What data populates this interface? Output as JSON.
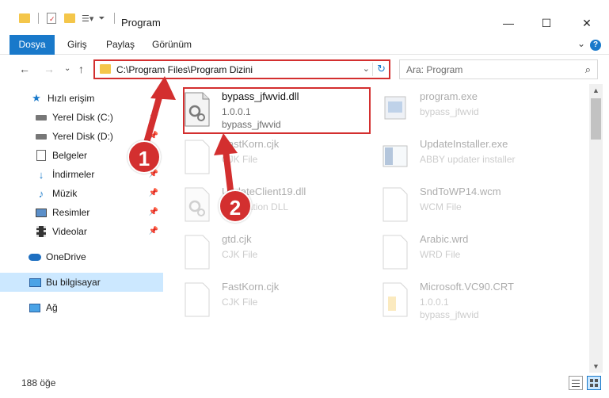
{
  "window": {
    "title": "Program",
    "minimize": "—",
    "maximize": "☐",
    "close": "✕"
  },
  "ribbon": {
    "tabs": [
      {
        "label": "Dosya",
        "active": true
      },
      {
        "label": "Giriş",
        "active": false
      },
      {
        "label": "Paylaş",
        "active": false
      },
      {
        "label": "Görünüm",
        "active": false
      }
    ],
    "help": "?"
  },
  "address": {
    "path": "C:\\Program Files\\Program Dizini",
    "search_placeholder": "Ara: Program"
  },
  "nav": {
    "items": [
      {
        "label": "Hızlı erişim",
        "icon": "star-icon",
        "pinned": false
      },
      {
        "label": "Yerel Disk (C:)",
        "icon": "drive-icon",
        "pinned": true
      },
      {
        "label": "Yerel Disk (D:)",
        "icon": "drive-icon",
        "pinned": true
      },
      {
        "label": "Belgeler",
        "icon": "documents-icon",
        "pinned": true
      },
      {
        "label": "İndirmeler",
        "icon": "download-icon",
        "pinned": true
      },
      {
        "label": "Müzik",
        "icon": "music-icon",
        "pinned": true
      },
      {
        "label": "Resimler",
        "icon": "pictures-icon",
        "pinned": true
      },
      {
        "label": "Videolar",
        "icon": "video-icon",
        "pinned": true
      },
      {
        "label": "OneDrive",
        "icon": "cloud-icon",
        "pinned": false
      },
      {
        "label": "Bu bilgisayar",
        "icon": "computer-icon",
        "pinned": false,
        "selected": true
      },
      {
        "label": "Ağ",
        "icon": "network-icon",
        "pinned": false
      }
    ]
  },
  "files": [
    {
      "name": "bypass_jfwvid.dll",
      "line2": "1.0.0.1",
      "line3": "bypass_jfwvid",
      "icon": "dll-file-icon",
      "faded": false
    },
    {
      "name": "program.exe",
      "line2": "bypass_jfwvid",
      "line3": "",
      "icon": "exe-file-icon",
      "faded": true
    },
    {
      "name": "FastKorn.cjk",
      "line2": "CJK File",
      "line3": "",
      "icon": "generic-file-icon",
      "faded": true
    },
    {
      "name": "UpdateInstaller.exe",
      "line2": "ABBY updater installer",
      "line3": "",
      "icon": "installer-icon",
      "faded": true
    },
    {
      "name": "UpdateClient19.dll",
      "line2": "Application DLL",
      "line3": "",
      "icon": "dll-file-icon",
      "faded": true
    },
    {
      "name": "SndToWP14.wcm",
      "line2": "WCM File",
      "line3": "",
      "icon": "generic-file-icon",
      "faded": true
    },
    {
      "name": "gtd.cjk",
      "line2": "CJK File",
      "line3": "",
      "icon": "generic-file-icon",
      "faded": true
    },
    {
      "name": "Arabic.wrd",
      "line2": "WRD File",
      "line3": "",
      "icon": "generic-file-icon",
      "faded": true
    },
    {
      "name": "FastKorn.cjk",
      "line2": "CJK File",
      "line3": "",
      "icon": "generic-file-icon",
      "faded": true
    },
    {
      "name": "Microsoft.VC90.CRT",
      "line2": "1.0.0.1",
      "line3": "bypass_jfwvid",
      "icon": "folder-icon",
      "faded": true
    }
  ],
  "status": {
    "count": "188 öğe"
  },
  "annotations": {
    "step1": "1",
    "step2": "2",
    "color": "#d32f2f"
  }
}
